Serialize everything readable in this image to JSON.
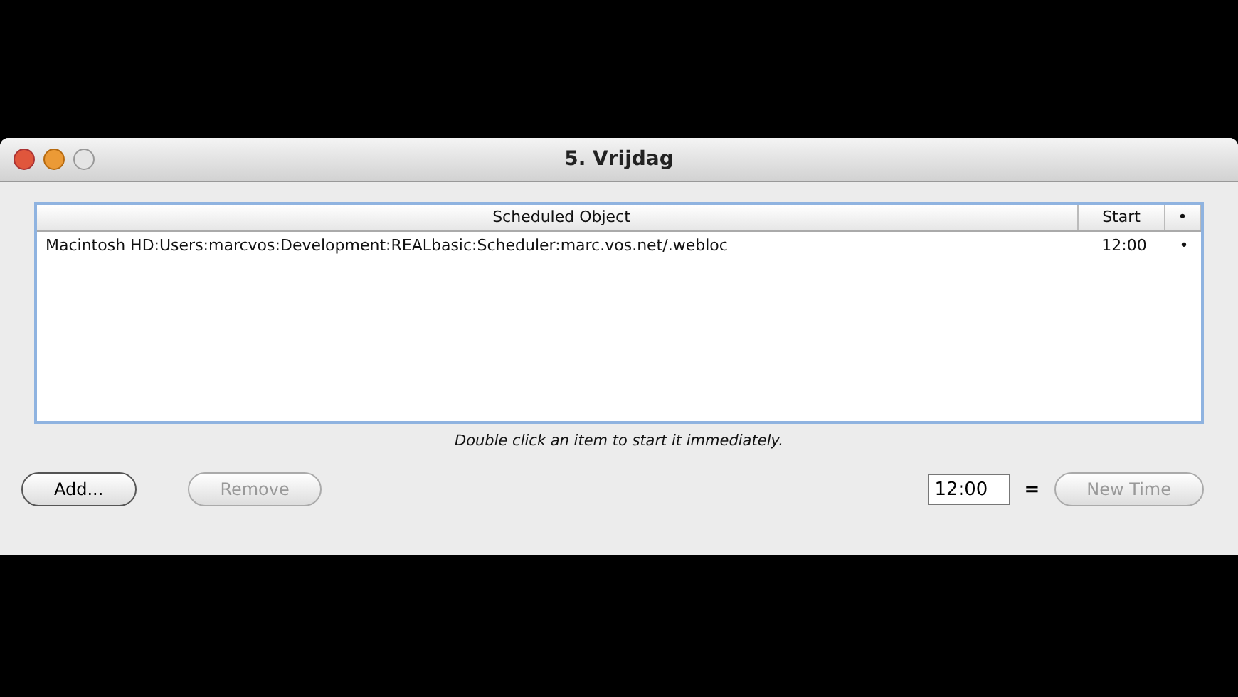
{
  "window": {
    "title": "5. Vrijdag"
  },
  "table": {
    "columns": [
      "Scheduled Object",
      "Start",
      "•"
    ],
    "rows": [
      {
        "cells": [
          "Macintosh HD:Users:marcvos:Development:REALbasic:Scheduler:marc.vos.net/.webloc",
          "12:00",
          "•"
        ]
      }
    ]
  },
  "hint": "Double click an item to start it immediately.",
  "buttons": [
    {
      "label": "Add...",
      "disabled": false
    },
    {
      "label": "Remove",
      "disabled": true
    }
  ],
  "time_field": {
    "value": "12:00"
  },
  "separator": "=",
  "new_time_button": {
    "label": "New Time",
    "disabled": true
  }
}
